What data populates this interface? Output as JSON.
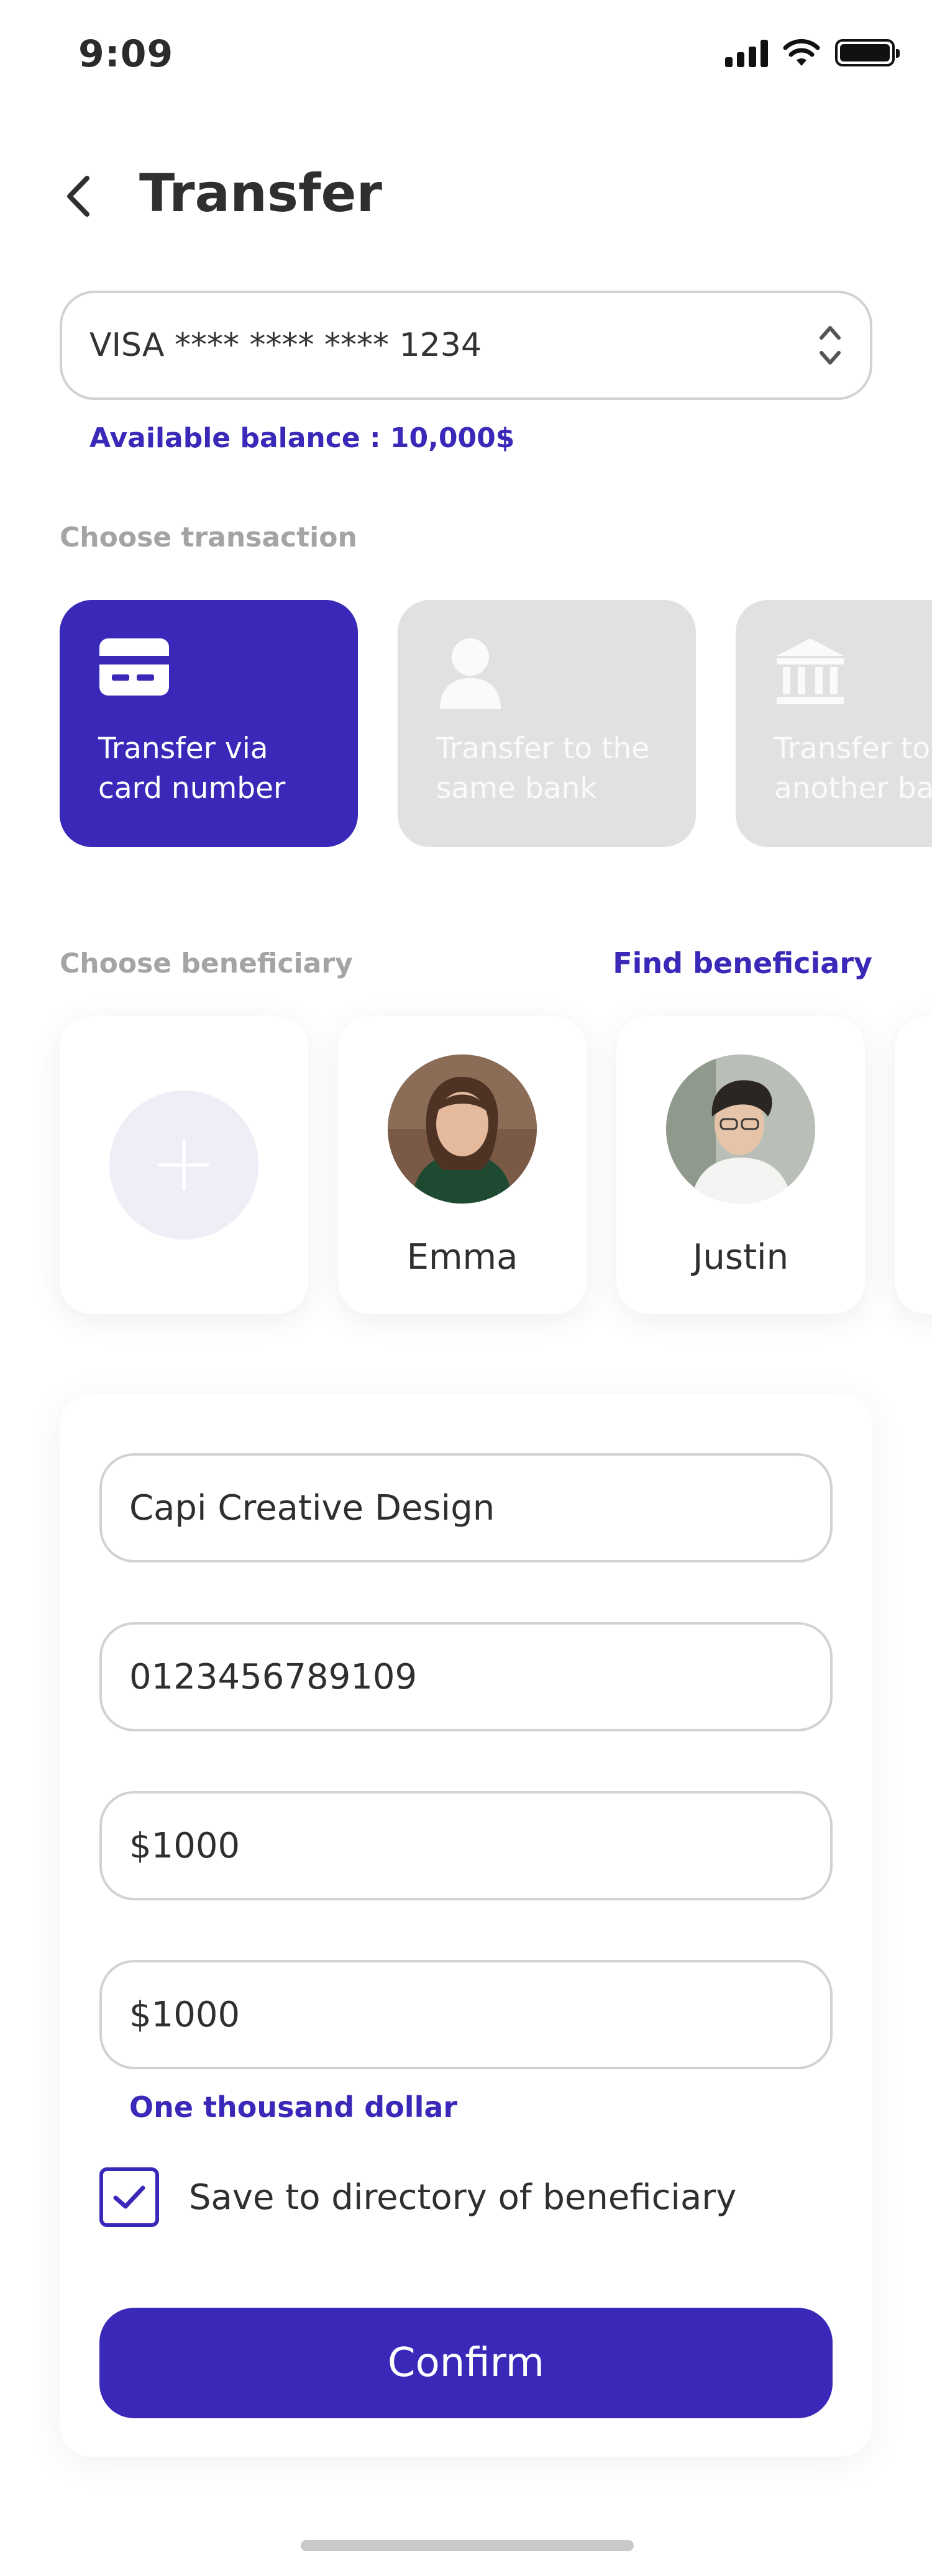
{
  "status_bar": {
    "time": "9:09"
  },
  "header": {
    "title": "Transfer"
  },
  "card_select": {
    "value": "VISA **** **** **** 1234"
  },
  "balance": {
    "text": "Available balance : 10,000$"
  },
  "transactions": {
    "label": "Choose transaction",
    "items": [
      {
        "label": "Transfer via card number",
        "icon": "card-icon",
        "active": true
      },
      {
        "label": "Transfer to the same bank",
        "icon": "person-icon",
        "active": false
      },
      {
        "label": "Transfer to another bank",
        "icon": "bank-icon",
        "active": false
      }
    ]
  },
  "beneficiary": {
    "label": "Choose beneficiary",
    "find_link": "Find beneficiary",
    "people": [
      {
        "name": "Emma"
      },
      {
        "name": "Justin"
      }
    ]
  },
  "form": {
    "name_value": "Capi Creative Design",
    "account_value": "0123456789109",
    "amount_value": "$1000",
    "amount_confirm_value": "$1000",
    "amount_words": "One thousand dollar",
    "save_label": "Save to directory of beneficiary",
    "save_checked": true,
    "confirm_label": "Confirm"
  },
  "colors": {
    "accent": "#3a28b8",
    "inactive_card": "#e1e1e1",
    "border": "#d2d2d2",
    "muted_text": "#a4a4a4"
  }
}
